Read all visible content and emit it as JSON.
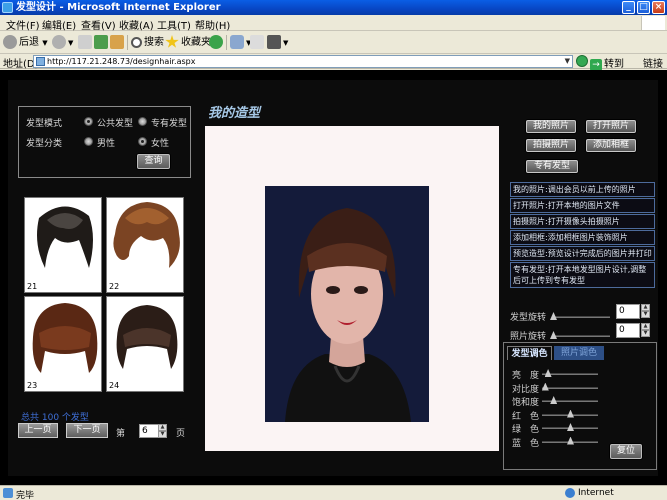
{
  "window": {
    "title": "发型设计 - Microsoft Internet Explorer",
    "controls": {
      "minimize": "_",
      "maximize": "□",
      "close": "×"
    }
  },
  "menu": [
    "文件(F)",
    "编辑(E)",
    "查看(V)",
    "收藏(A)",
    "工具(T)",
    "帮助(H)"
  ],
  "toolbar": {
    "back": "后退",
    "search": "搜索",
    "favorites": "收藏夹"
  },
  "address": {
    "label": "地址(D)",
    "url": "http://117.21.248.73/designhair.aspx",
    "go": "转到",
    "links": "链接"
  },
  "options": {
    "mode_label": "发型模式",
    "mode_public": "公共发型",
    "mode_private": "专有发型",
    "category_label": "发型分类",
    "category_male": "男性",
    "category_female": "女性",
    "query_button": "查询"
  },
  "hairstyles": [
    {
      "num": "21"
    },
    {
      "num": "22"
    },
    {
      "num": "23"
    },
    {
      "num": "24"
    }
  ],
  "pagination": {
    "total": "总共 100 个发型",
    "prev": "上一页",
    "next": "下一页",
    "page_prefix": "第",
    "page_value": "6",
    "page_suffix": "页"
  },
  "design": {
    "title": "我的造型"
  },
  "actions": {
    "my_photo": "我的照片",
    "open_photo": "打开照片",
    "capture_photo": "拍摄照片",
    "add_frame": "添加相框",
    "private_hair": "专有发型"
  },
  "tips": [
    "我的照片:调出会员以前上传的照片",
    "打开照片:打开本地的图片文件",
    "拍摄照片:打开摄像头拍摄照片",
    "添加相框:添加相框图片装饰照片",
    "预览造型:预览设计完成后的图片并打印",
    "专有发型:打开本地发型图片设计,调整后可上传到专有发型"
  ],
  "rotation": {
    "hair_label": "发型旋转",
    "hair_value": "0",
    "photo_label": "照片旋转",
    "photo_value": "0"
  },
  "color_panel": {
    "tab_hair": "发型调色",
    "tab_photo": "照片调色",
    "sliders": [
      {
        "label": "亮　度",
        "value": 0.1
      },
      {
        "label": "对比度",
        "value": 0.05
      },
      {
        "label": "饱和度",
        "value": 0.2
      },
      {
        "label": "红　色",
        "value": 0.5
      },
      {
        "label": "绿　色",
        "value": 0.5
      },
      {
        "label": "蓝　色",
        "value": 0.5
      }
    ],
    "reset": "复位"
  },
  "status": {
    "text": "完毕",
    "zone": "Internet"
  },
  "colors": {
    "titlebar": "#0846C4",
    "accent_blue": "#3f6fd6",
    "page_bg": "#000000"
  }
}
